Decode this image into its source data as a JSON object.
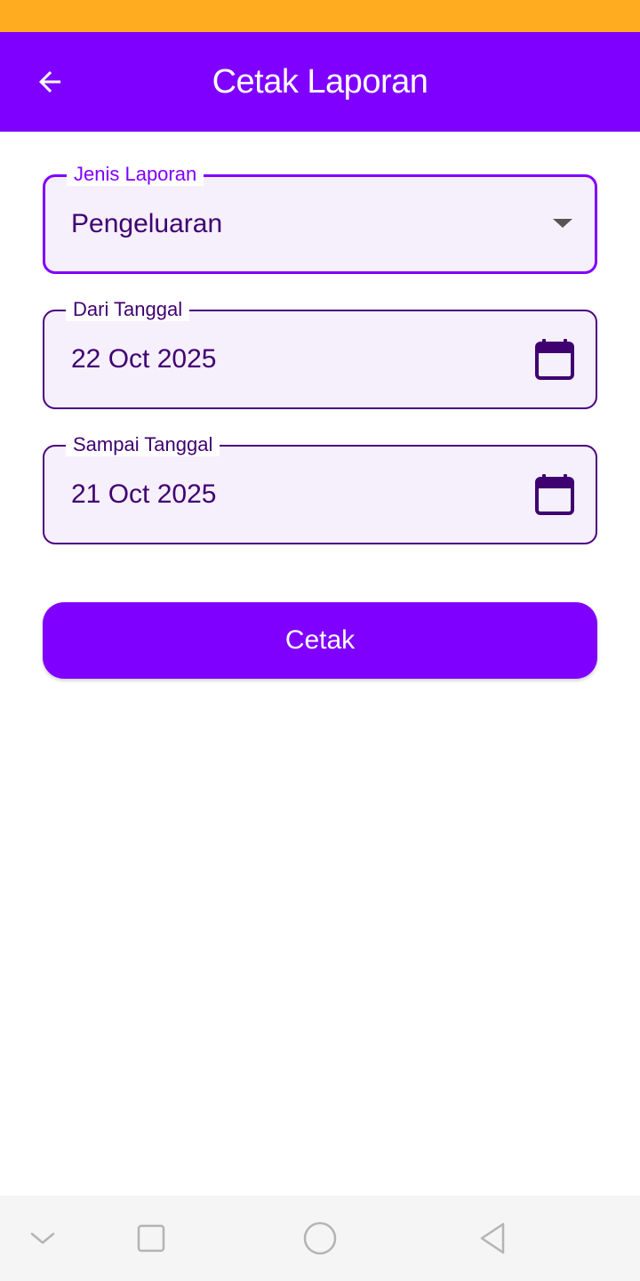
{
  "app_bar": {
    "title": "Cetak Laporan",
    "back_icon": "arrow-left-icon"
  },
  "form": {
    "report_type": {
      "label": "Jenis Laporan",
      "value": "Pengeluaran",
      "icon": "dropdown-arrow-icon"
    },
    "date_from": {
      "label": "Dari Tanggal",
      "value": "22 Oct 2025",
      "icon": "calendar-icon"
    },
    "date_to": {
      "label": "Sampai Tanggal",
      "value": "21 Oct 2025",
      "icon": "calendar-icon"
    }
  },
  "print_button": {
    "label": "Cetak"
  },
  "nav_bar": {
    "icons": [
      "collapse-icon",
      "recents-icon",
      "home-icon",
      "back-icon"
    ]
  },
  "colors": {
    "status_bar": "#FFAC21",
    "primary": "#7F00FF",
    "field_text": "#3F0070",
    "field_bg": "#F6EFFC"
  }
}
